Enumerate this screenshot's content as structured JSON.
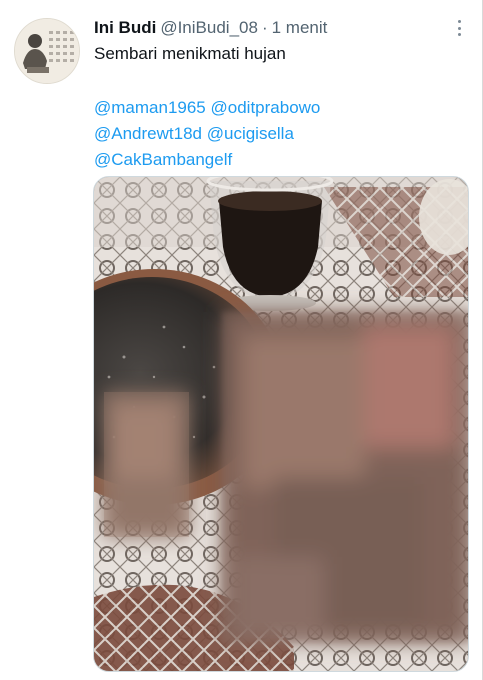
{
  "tweet": {
    "display_name": "Ini Budi",
    "handle": "@IniBudi_08",
    "separator": "·",
    "time": "1 menit",
    "text": "Sembari menikmati hujan",
    "mentions": [
      [
        "@maman1965",
        "@oditprabowo"
      ],
      [
        "@Andrewt18d",
        "@ucigisella"
      ],
      [
        "@CakBambangelf"
      ]
    ]
  },
  "colors": {
    "link": "#1d9bf0",
    "text": "#0f1419",
    "muted": "#536471"
  },
  "icons": {
    "more": "more-vertical-icon",
    "avatar": "avatar"
  }
}
